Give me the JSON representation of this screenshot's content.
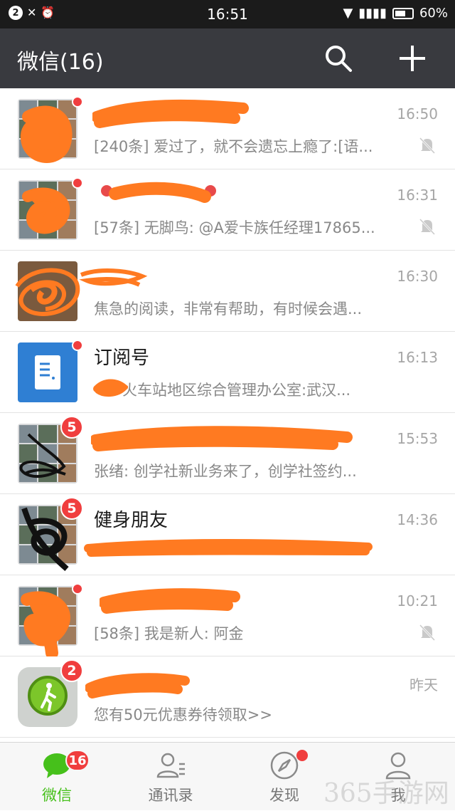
{
  "status_bar": {
    "notification_count": "2",
    "time": "16:51",
    "battery": "60%",
    "battery_level": 0.6
  },
  "app_bar": {
    "title": "微信(16)",
    "search_icon": "search-icon",
    "add_icon": "plus-icon"
  },
  "chats": [
    {
      "name": "",
      "preview": "[240条] 爱过了，就不会遗忘上瘾了:[语...",
      "time": "16:50",
      "muted": true,
      "unread_dot": true
    },
    {
      "name": "",
      "preview": "[57条] 无脚鸟: @A爱卡族任经理17865...",
      "time": "16:31",
      "muted": true,
      "unread_dot": true
    },
    {
      "name": "",
      "preview": "焦急的阅读，非常有帮助，有时候会遇...",
      "time": "16:30",
      "muted": false,
      "unread_dot": false
    },
    {
      "name": "订阅号",
      "preview": "火车站地区综合管理办公室:武汉...",
      "time": "16:13",
      "muted": false,
      "unread_dot": true
    },
    {
      "name": "",
      "preview": "张绪: 创学社新业务来了，创学社签约...",
      "time": "15:53",
      "muted": false,
      "badge": "5"
    },
    {
      "name": "健身朋友",
      "preview": "",
      "time": "14:36",
      "muted": false,
      "badge": "5"
    },
    {
      "name": "",
      "preview": "[58条] 我是新人: 阿金",
      "time": "10:21",
      "muted": true,
      "unread_dot": true
    },
    {
      "name": "",
      "preview": "您有50元优惠券待领取>>",
      "time": "昨天",
      "muted": false,
      "badge": "2"
    }
  ],
  "tabs": [
    {
      "label": "微信",
      "icon": "chat-bubble-icon",
      "badge": "16",
      "active": true
    },
    {
      "label": "通讯录",
      "icon": "contacts-icon"
    },
    {
      "label": "发现",
      "icon": "compass-icon",
      "dot": true
    },
    {
      "label": "我",
      "icon": "person-icon"
    }
  ],
  "watermark": "365手游网",
  "colors": {
    "status_bar": "#1b1b1b",
    "app_bar": "#393a3f",
    "accent_green": "#46c01b",
    "badge_red": "#f03e3e",
    "scribble_orange": "#ff7a21"
  }
}
